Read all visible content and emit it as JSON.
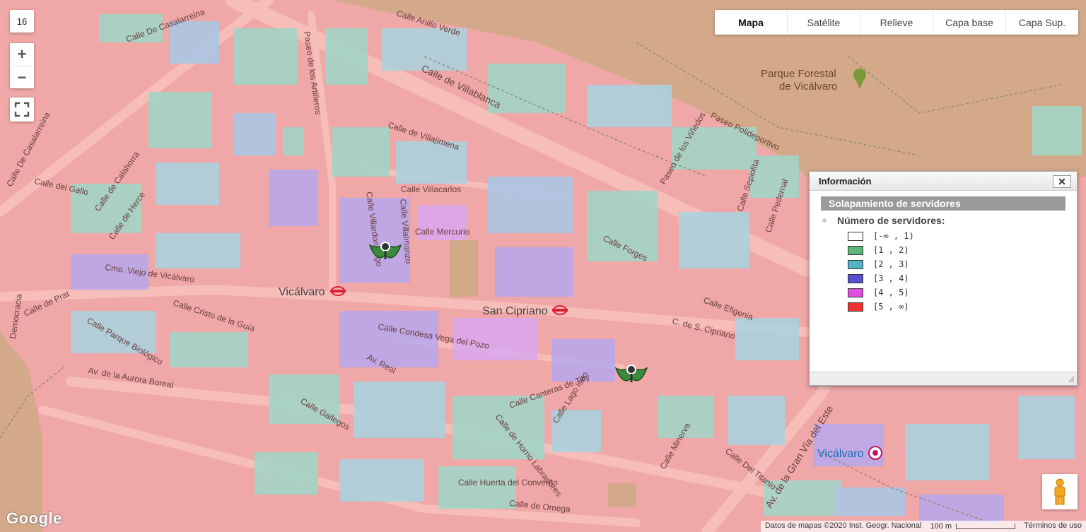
{
  "map": {
    "zoom_level": "16",
    "map_types": [
      {
        "label": "Mapa",
        "active": true
      },
      {
        "label": "Satélite",
        "active": false
      },
      {
        "label": "Relieve",
        "active": false
      },
      {
        "label": "Capa base",
        "active": false
      },
      {
        "label": "Capa Sup.",
        "active": false
      }
    ],
    "streets": [
      "Calle De Casalarreina",
      "Calle Anillo Verde",
      "Paseo de los Artilleros",
      "Calle de Villablanca",
      "Calle de Villajimena",
      "Calle Villacarlos",
      "Calle Mercurio",
      "Calle Villardondiego",
      "Calle Villalmanzo",
      "Calle del Gallo",
      "Calle de Calahorra",
      "Calle de Herce",
      "Cmo. Viejo de Vicálvaro",
      "Calle de Prat",
      "Calle Cristo de la Guía",
      "Calle Parque Biológico",
      "Av. de la Aurora Boreal",
      "Calle Gallegos",
      "Calle Condesa Vega del Pozo",
      "Av. Real",
      "Calle Canteras de Tilly",
      "Calle Lago Iseo",
      "Calle de Horno Labradores",
      "Calle Huerta del Convento",
      "Calle de Omega",
      "Calle Minerva",
      "Calle Del Titanio",
      "Av. de la Gran Vía del Este",
      "C. de S. Cipriano",
      "Calle Efigenia",
      "Calle Forges",
      "Paseo de los Viñedos",
      "Paseo Polideportivo",
      "Calle Sepiolita",
      "Calle Pedernal",
      "Democracia",
      "Calle De Casalarreina"
    ],
    "places": {
      "park": "Parque Forestal de Vicálvaro",
      "metro_1": "Vicálvaro",
      "metro_2": "San Cipriano",
      "station": "Vicálvaro"
    }
  },
  "info_panel": {
    "title": "Información",
    "close_label": "✕",
    "section": "Solapamiento de servidores",
    "subtitle": "Número de servidores:",
    "legend": [
      {
        "label": "[-∞ , 1)",
        "color": "#ffffff"
      },
      {
        "label": "[1 , 2)",
        "color": "#5fb577"
      },
      {
        "label": "[2 , 3)",
        "color": "#55b3c6"
      },
      {
        "label": "[3 , 4)",
        "color": "#5a4fd0"
      },
      {
        "label": "[4 , 5)",
        "color": "#e04de0"
      },
      {
        "label": "[5 , ∞)",
        "color": "#ee3333"
      }
    ]
  },
  "footer": {
    "attribution": "Datos de mapas ©2020 Inst. Geogr. Nacional",
    "scale": "100 m",
    "terms": "Términos de uso",
    "logo": "Google"
  },
  "colors": {
    "coverage_base": "#efa7a7",
    "park": "#d4a98a",
    "road": "#f4b8b4"
  }
}
